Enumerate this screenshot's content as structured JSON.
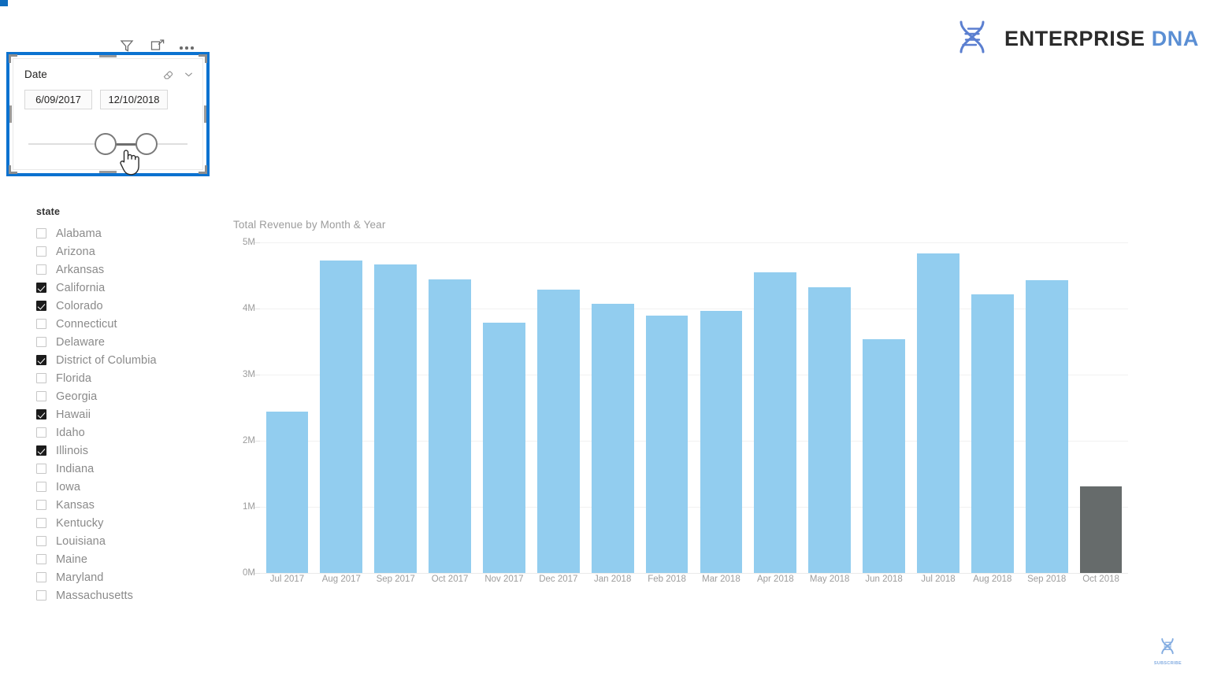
{
  "brand": {
    "name_primary": "ENTERPRISE",
    "name_secondary": "DNA",
    "helix_icon": "dna-helix-icon",
    "color_primary": "#2b2b2b",
    "color_secondary": "#5b8fd4"
  },
  "visual_toolbar": {
    "filter_icon": "filter-funnel-icon",
    "focus_icon": "focus-mode-icon",
    "more_icon": "more-options-icon"
  },
  "date_slicer": {
    "title": "Date",
    "clear_icon": "eraser-clear-filter-icon",
    "collapse_icon": "chevron-down-icon",
    "start_date": "6/09/2017",
    "end_date": "12/10/2018",
    "selected": true,
    "selection_color": "#0b72d0",
    "cursor_icon": "pointing-hand-cursor",
    "left_handle": "slider-handle-left",
    "right_handle": "slider-handle-right"
  },
  "state_slicer": {
    "title": "state",
    "items": [
      {
        "label": "Alabama",
        "checked": false
      },
      {
        "label": "Arizona",
        "checked": false
      },
      {
        "label": "Arkansas",
        "checked": false
      },
      {
        "label": "California",
        "checked": true
      },
      {
        "label": "Colorado",
        "checked": true
      },
      {
        "label": "Connecticut",
        "checked": false
      },
      {
        "label": "Delaware",
        "checked": false
      },
      {
        "label": "District of Columbia",
        "checked": true
      },
      {
        "label": "Florida",
        "checked": false
      },
      {
        "label": "Georgia",
        "checked": false
      },
      {
        "label": "Hawaii",
        "checked": true
      },
      {
        "label": "Idaho",
        "checked": false
      },
      {
        "label": "Illinois",
        "checked": true
      },
      {
        "label": "Indiana",
        "checked": false
      },
      {
        "label": "Iowa",
        "checked": false
      },
      {
        "label": "Kansas",
        "checked": false
      },
      {
        "label": "Kentucky",
        "checked": false
      },
      {
        "label": "Louisiana",
        "checked": false
      },
      {
        "label": "Maine",
        "checked": false
      },
      {
        "label": "Maryland",
        "checked": false
      },
      {
        "label": "Massachusetts",
        "checked": false
      }
    ]
  },
  "subscribe": {
    "label": "SUBSCRIBE",
    "icon": "dna-helix-icon"
  },
  "chart_data": {
    "type": "bar",
    "title": "Total Revenue by Month & Year",
    "xlabel": "",
    "ylabel": "",
    "ylim": [
      0,
      5000000
    ],
    "grid": true,
    "legend": false,
    "ytick_labels": [
      "0M",
      "1M",
      "2M",
      "3M",
      "4M",
      "5M"
    ],
    "ytick_values": [
      0,
      1000000,
      2000000,
      3000000,
      4000000,
      5000000
    ],
    "bar_color": "#92cdef",
    "highlight_color": "#666b6b",
    "categories": [
      "Jul 2017",
      "Aug 2017",
      "Sep 2017",
      "Oct 2017",
      "Nov 2017",
      "Dec 2017",
      "Jan 2018",
      "Feb 2018",
      "Mar 2018",
      "Apr 2018",
      "May 2018",
      "Jun 2018",
      "Jul 2018",
      "Aug 2018",
      "Sep 2018",
      "Oct 2018"
    ],
    "values": [
      2440000,
      4730000,
      4670000,
      4440000,
      3780000,
      4280000,
      4070000,
      3890000,
      3970000,
      4550000,
      4320000,
      3540000,
      4830000,
      4220000,
      4430000,
      1310000
    ],
    "highlighted": [
      false,
      false,
      false,
      false,
      false,
      false,
      false,
      false,
      false,
      false,
      false,
      false,
      false,
      false,
      false,
      true
    ]
  }
}
